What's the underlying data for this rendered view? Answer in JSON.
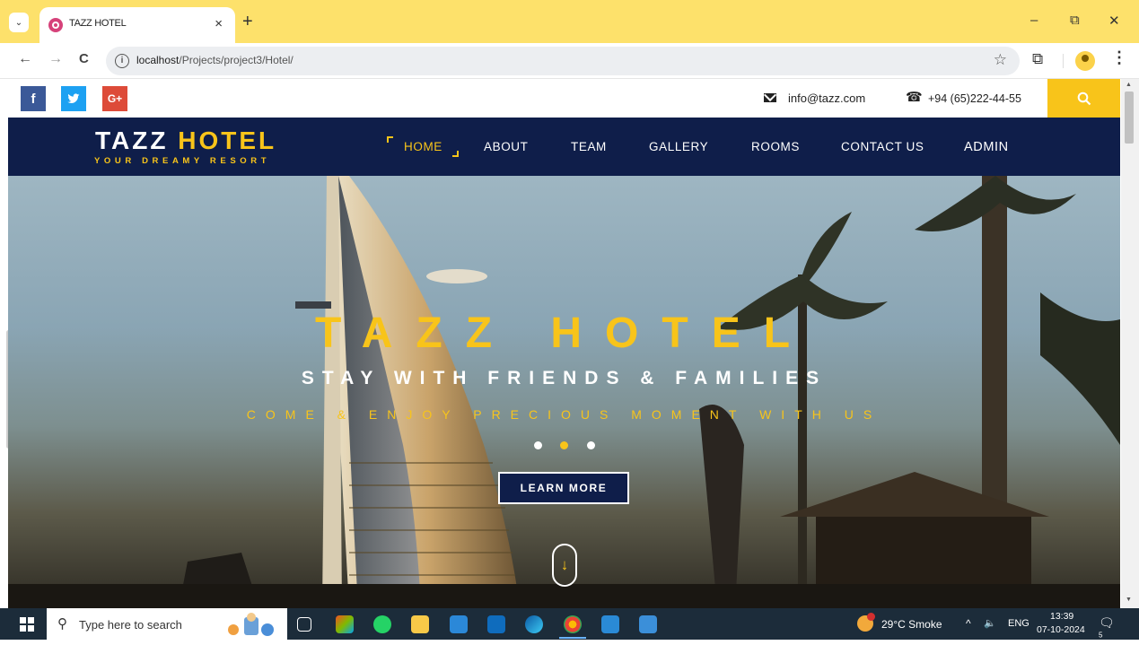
{
  "browser": {
    "tab_title": "TAZZ HOTEL",
    "tab_close": "×",
    "new_tab": "+",
    "url_host": "localhost",
    "url_path": "/Projects/project3/Hotel/",
    "window_controls": {
      "minimize": "–",
      "restore": "⧉",
      "close": "✕"
    },
    "nav": {
      "back": "←",
      "forward": "→",
      "reload": "C"
    }
  },
  "site": {
    "social": [
      {
        "name": "facebook",
        "label": "f"
      },
      {
        "name": "twitter",
        "label": "t"
      },
      {
        "name": "google-plus",
        "label": "G+"
      }
    ],
    "contact": {
      "email": "info@tazz.com",
      "phone": "+94 (65)222-44-55"
    },
    "brand": {
      "name_part1": "TAZZ ",
      "name_part2": "HOTEL",
      "tagline": "YOUR DREAMY RESORT"
    },
    "nav": [
      {
        "label": "HOME",
        "active": true
      },
      {
        "label": "ABOUT",
        "active": false
      },
      {
        "label": "TEAM",
        "active": false
      },
      {
        "label": "GALLERY",
        "active": false
      },
      {
        "label": "ROOMS",
        "active": false
      },
      {
        "label": "CONTACT US",
        "active": false
      },
      {
        "label": "ADMIN",
        "active": false
      }
    ],
    "hero": {
      "title": "TAZZ HOTEL",
      "subtitle": "STAY WITH FRIENDS & FAMILIES",
      "tagline": "COME & ENJOY PRECIOUS MOMENT WITH US",
      "button": "LEARN MORE",
      "slides": 3,
      "active_slide": 2,
      "scroll_cue": "↓"
    },
    "colors": {
      "accent": "#f8c41a",
      "navy": "#0f1e4a"
    }
  },
  "taskbar": {
    "search_placeholder": "Type here to search",
    "weather": "29°C  Smoke",
    "language": "ENG",
    "time": "13:39",
    "date": "07-10-2024",
    "notification_count": "5",
    "tray_chevron": "^",
    "speaker": "🔈"
  }
}
